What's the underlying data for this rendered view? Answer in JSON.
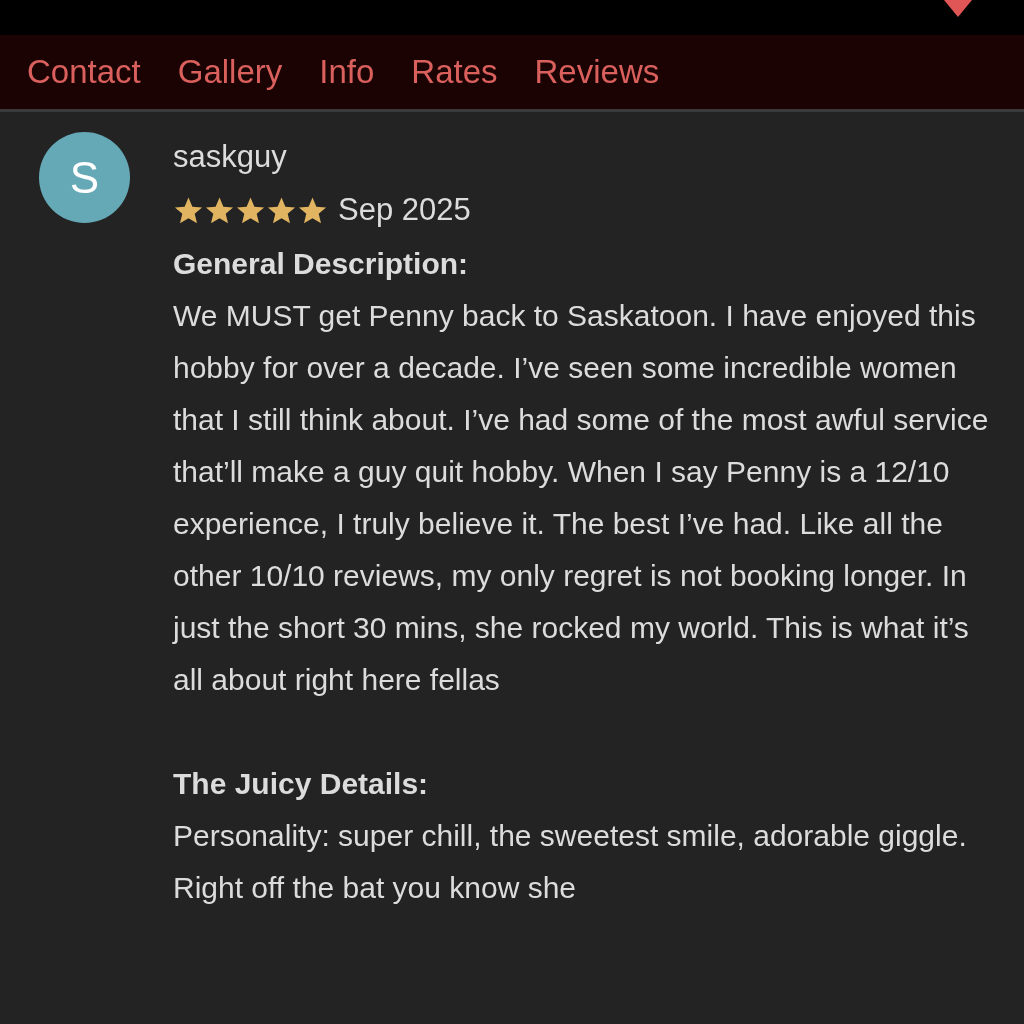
{
  "tabs": [
    {
      "label": "Contact"
    },
    {
      "label": "Gallery"
    },
    {
      "label": "Info"
    },
    {
      "label": "Rates"
    },
    {
      "label": "Reviews"
    }
  ],
  "review": {
    "avatar_letter": "S",
    "author": "saskguy",
    "stars": 5,
    "date": "Sep 2025",
    "sections": [
      {
        "heading": "General Description:",
        "text": "We MUST get Penny back to Saskatoon. I have enjoyed this hobby for over a decade. I’ve seen some incredible women that I still think about. I’ve had some of the most awful service that’ll make a guy quit hobby. When I say Penny is a 12/10 experience, I truly believe it. The best I’ve had. Like all the other 10/10 reviews, my only regret is not booking longer. In just the short 30 mins, she rocked my world. This is what it’s all about right here fellas"
      },
      {
        "heading": "The Juicy Details:",
        "text": "Personality: super chill, the sweetest smile, adorable giggle. Right off the bat you know she"
      }
    ]
  }
}
